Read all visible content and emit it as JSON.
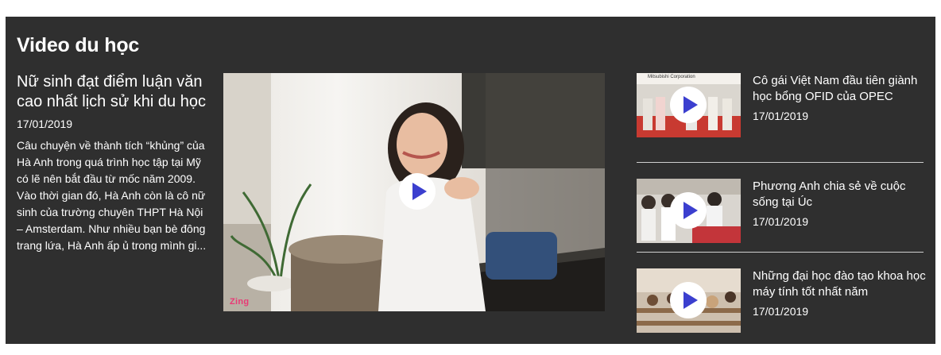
{
  "section": {
    "title": "Video du học"
  },
  "featured": {
    "title": "Nữ sinh đạt điểm luận văn cao nhất lịch sử khi du học",
    "date": "17/01/2019",
    "summary": "Câu chuyện về thành tích “khủng” của Hà Anh trong quá trình học tập tại Mỹ có lẽ nên bắt đầu từ mốc năm 2009. Vào thời gian đó, Hà Anh còn là cô nữ sinh của trường chuyên THPT Hà Nội – Amsterdam. Như nhiều bạn bè đông trang lứa, Hà Anh ấp ủ trong mình gi...",
    "watermark": "Zing",
    "play_icon": "play-icon"
  },
  "side_items": [
    {
      "title": "Cô gái Việt Nam đầu tiên giành học bổng OFID của OPEC",
      "date": "17/01/2019",
      "banner_text": "Mitsubishi Corporation"
    },
    {
      "title": "Phương Anh chia sẻ về cuộc sống tại Úc",
      "date": "17/01/2019"
    },
    {
      "title": "Những đại học đào tạo khoa học máy tính tốt nhất năm",
      "date": "17/01/2019"
    }
  ],
  "colors": {
    "panel": "#2f2f2f",
    "text": "#ffffff",
    "play": "#3b3fcf",
    "divider": "#cfcfcf"
  }
}
